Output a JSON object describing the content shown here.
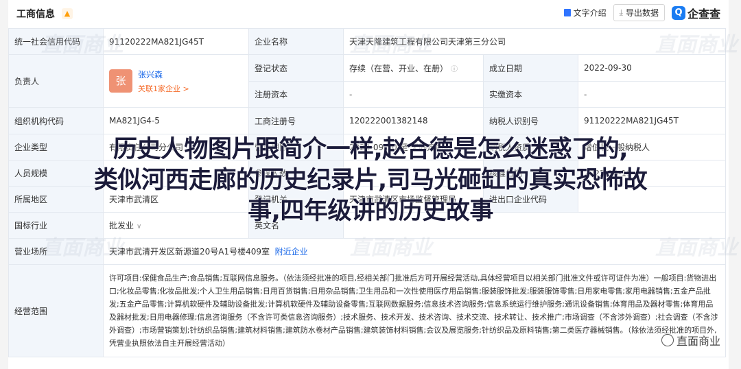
{
  "header": {
    "title": "工商信息",
    "text_intro": "文字介绍",
    "export": "导出数据",
    "brand": "企查查",
    "brand_mark": "Q"
  },
  "rows": {
    "credit_code_label": "统一社会信用代码",
    "credit_code": "91120222MA821JG45T",
    "company_name_label": "企业名称",
    "company_name": "天津天隆建筑工程有限公司天津第三分公司",
    "legal_person_label": "负责人",
    "person_avatar": "张",
    "person_name": "张兴森",
    "person_assoc": "关联1家企业 >",
    "reg_status_label": "登记状态",
    "reg_status": "存续（在营、开业、在册）",
    "est_date_label": "成立日期",
    "est_date": "2022-09-30",
    "reg_capital_label": "注册资本",
    "reg_capital": "-",
    "paid_capital_label": "实缴资本",
    "paid_capital": "-",
    "org_code_label": "组织机构代码",
    "org_code": "MA821JG4-5",
    "reg_no_label": "工商注册号",
    "reg_no": "120222001382148",
    "taxpayer_id_label": "纳税人识别号",
    "taxpayer_id": "91120222MA821JG45T",
    "company_type_label": "企业类型",
    "company_type": "有限责任公司分公司",
    "biz_term_label": "营业期限",
    "biz_term": "2022-09-30 至 无固定期限",
    "taxpayer_qual_label": "纳税人资质",
    "taxpayer_qual": "增值税一般纳税人",
    "staff_size_label": "人员规模",
    "staff_size": "",
    "insured_label": "参保人数",
    "insured": "",
    "approve_date_label": "核准日期",
    "approve_date": "2022-10-19",
    "region_label": "所属地区",
    "region": "天津市武清区",
    "authority_label": "登记机关",
    "authority": "天津市武清区市场监督管理局",
    "import_export_label": "进出口企业代码",
    "import_export": "",
    "industry_label": "国标行业",
    "industry": "批发业",
    "former_name_label": "英文名",
    "former_name": "",
    "address_label": "营业场所",
    "address": "天津市武清开发区新源道20号A1号楼409室",
    "nearby": "附近企业",
    "scope_label": "经营范围",
    "scope": "许可项目:保健食品生产;食品销售;互联网信息服务。（依法须经批准的项目,经相关部门批准后方可开展经营活动,具体经营项目以相关部门批准文件或许可证件为准）一般项目:货物进出口;化妆品零售;化妆品批发;个人卫生用品销售;日用百货销售;日用杂品销售;卫生用品和一次性使用医疗用品销售;服装服饰批发;服装服饰零售;日用家电零售;家用电器销售;五金产品批发;五金产品零售;计算机软硬件及辅助设备批发;计算机软硬件及辅助设备零售;互联网数据服务;信息技术咨询服务;信息系统运行维护服务;通讯设备销售;体育用品及器材零售;体育用品及器材批发;日用电器修理;信息咨询服务（不含许可类信息咨询服务）;技术服务、技术开发、技术咨询、技术交流、技术转让、技术推广;市场调查（不含涉外调查）;社会调查（不含涉外调查）;市场营销策划;针纺织品销售;建筑材料销售;建筑防水卷材产品销售;建筑装饰材料销售;会议及展览服务;针纺织品及原料销售;第二类医疗器械销售。（除依法须经批准的项目外,凭营业执照依法自主开展经营活动）"
  },
  "overlay": {
    "line1": "历史人物图片跟简介一样,赵合德是怎么迷惑了的,",
    "line2": "类似河西走廊的历史纪录片,司马光砸缸的真实恐怖故",
    "line3": "事,四年级讲的历史故事"
  },
  "watermark": {
    "text": "直面商业",
    "corner": "直面商业"
  }
}
